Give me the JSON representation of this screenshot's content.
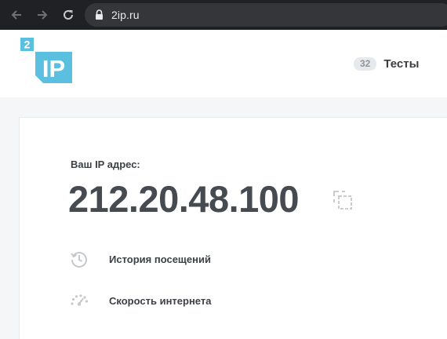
{
  "browser": {
    "url": "2ip.ru"
  },
  "header": {
    "logo": {
      "superscript": "2",
      "text": "IP",
      "color": "#5bc0e0"
    },
    "tests_count": "32",
    "tests_label": "Тесты"
  },
  "main": {
    "ip_label": "Ваш IP адрес:",
    "ip_value": "212.20.48.100",
    "links": [
      {
        "label": "История посещений",
        "icon": "history-icon"
      },
      {
        "label": "Скорость интернета",
        "icon": "speedometer-icon"
      }
    ]
  }
}
